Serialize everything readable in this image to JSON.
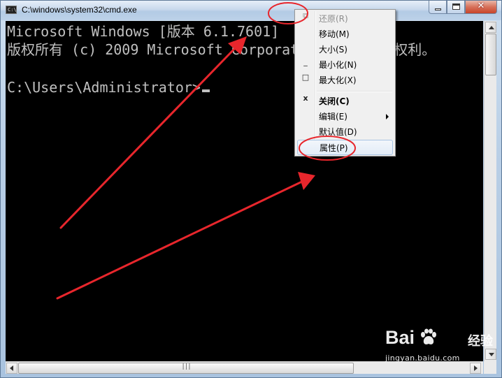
{
  "window": {
    "title": "C:\\windows\\system32\\cmd.exe",
    "icon_text": "C:\\"
  },
  "console": {
    "lines": [
      "Microsoft Windows [版本 6.1.7601]",
      "版权所有 (c) 2009 Microsoft Corporation。保留所有权利。",
      "",
      "C:\\Users\\Administrator>"
    ]
  },
  "context_menu": {
    "items": [
      {
        "icon": "restore-icon",
        "glyph": "⧉",
        "label": "还原(R)",
        "disabled": true
      },
      {
        "icon": "",
        "glyph": "",
        "label": "移动(M)"
      },
      {
        "icon": "",
        "glyph": "",
        "label": "大小(S)"
      },
      {
        "icon": "minimize-icon",
        "glyph": "_",
        "label": "最小化(N)"
      },
      {
        "icon": "maximize-icon",
        "glyph": "□",
        "label": "最大化(X)"
      },
      {
        "icon": "close-icon",
        "glyph": "x",
        "label": "关闭(C)",
        "bold": true
      },
      {
        "icon": "",
        "glyph": "",
        "label": "编辑(E)",
        "submenu": true
      },
      {
        "icon": "",
        "glyph": "",
        "label": "默认值(D)"
      },
      {
        "icon": "",
        "glyph": "",
        "label": "属性(P)",
        "highlighted": true
      }
    ]
  },
  "scrollbar": {
    "hthumb_grip": "|||"
  },
  "annotation": {
    "color": "#e8262c"
  },
  "watermark": {
    "logo_left": "Bai",
    "logo_right": "经验",
    "url": "jingyan.baidu.com"
  }
}
